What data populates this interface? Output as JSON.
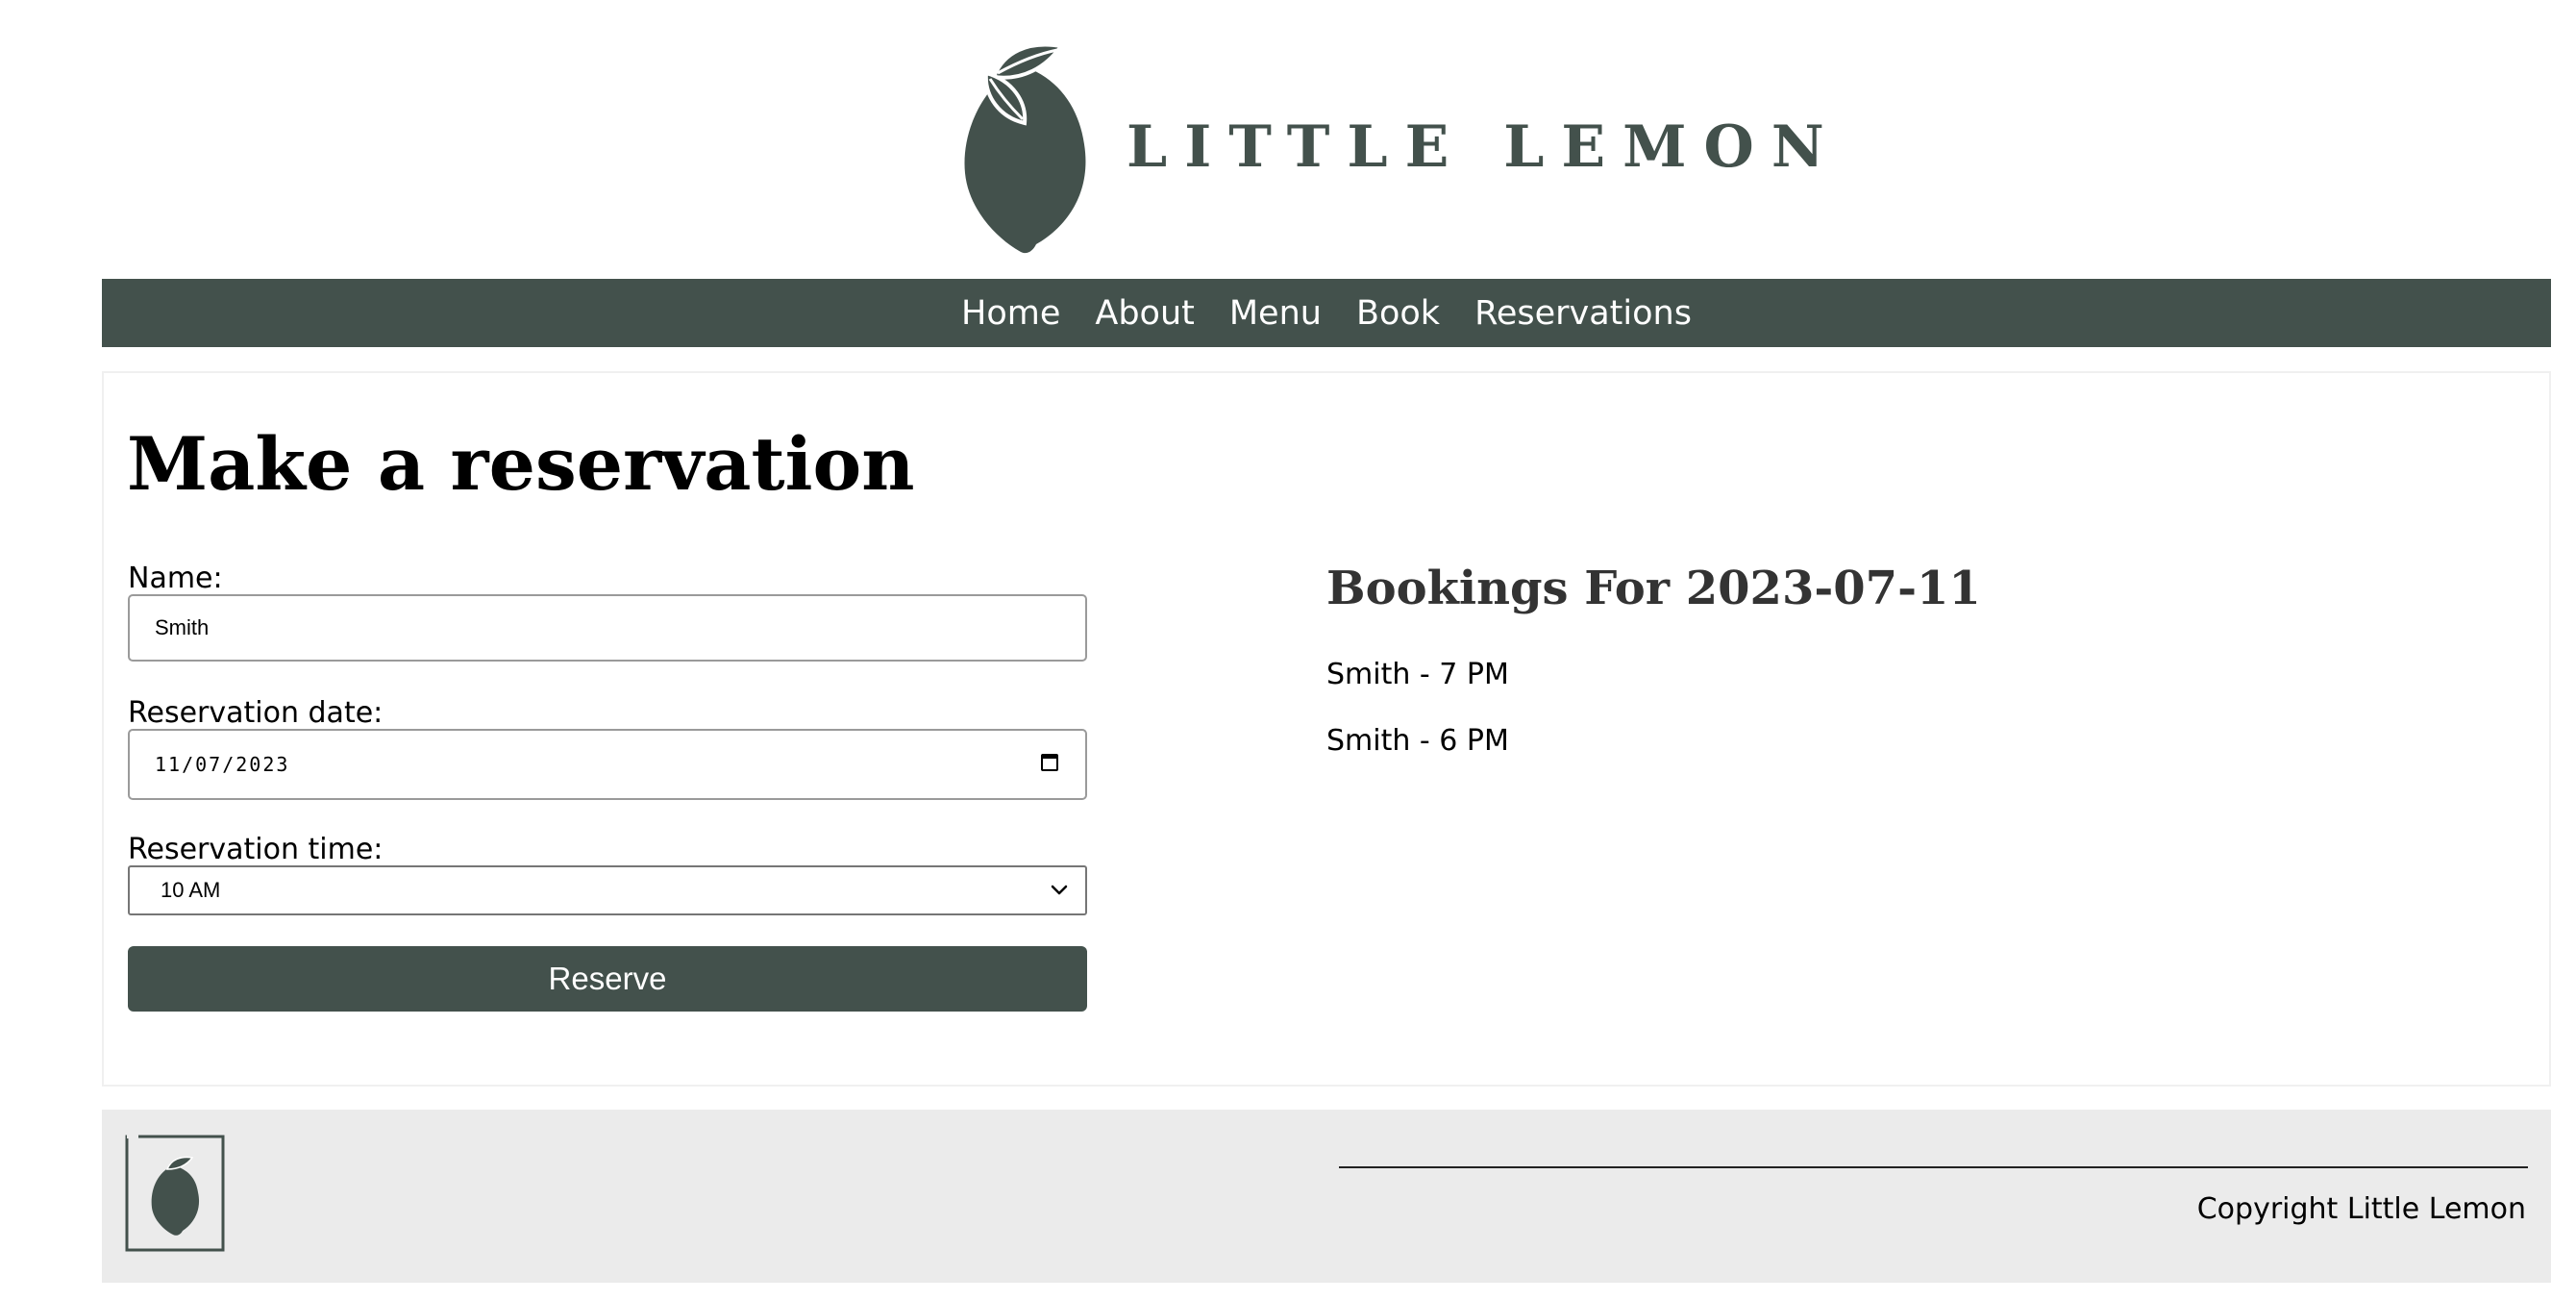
{
  "brand": {
    "name": "LITTLE LEMON",
    "color": "#43514c"
  },
  "nav": {
    "items": [
      "Home",
      "About",
      "Menu",
      "Book",
      "Reservations"
    ]
  },
  "form": {
    "title": "Make a reservation",
    "name_label": "Name:",
    "name_value": "Smith",
    "date_label": "Reservation date:",
    "date_value": "11/07/2023",
    "time_label": "Reservation time:",
    "time_value": "10 AM",
    "submit_label": "Reserve"
  },
  "bookings": {
    "title": "Bookings For 2023-07-11",
    "items": [
      "Smith - 7 PM",
      "Smith - 6 PM"
    ]
  },
  "footer": {
    "copyright": "Copyright Little Lemon"
  },
  "icons": {
    "logo": "lemon-icon",
    "date_picker": "calendar-icon",
    "select": "chevron-down-icon"
  }
}
